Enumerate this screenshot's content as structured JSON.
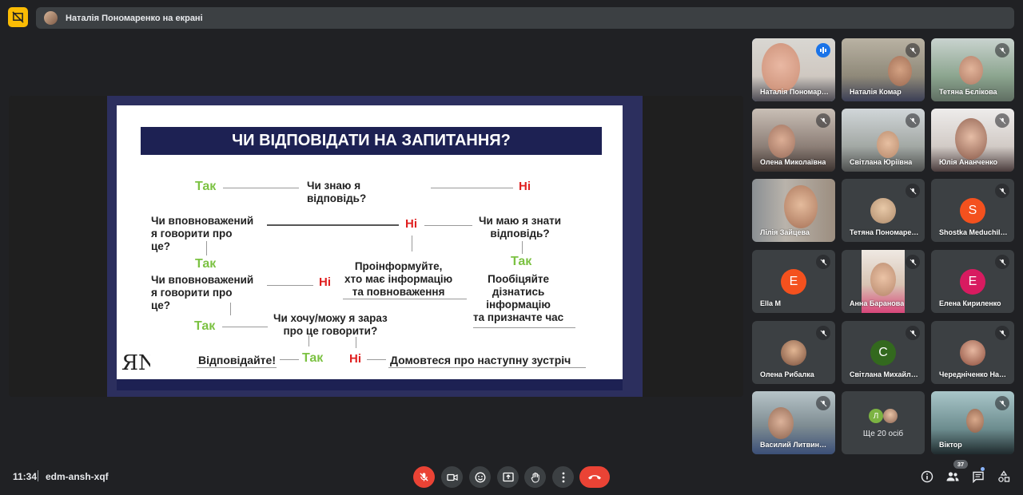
{
  "presenting_banner": "Наталія Пономаренко на екрані",
  "slide": {
    "title": "ЧИ ВІДПОВІДАТИ НА ЗАПИТАННЯ?",
    "tak": "Так",
    "ni": "Ні",
    "q1": "Чи знаю я\nвідповідь?",
    "q2": "Чи вповноважений\nя говорити про\nце?",
    "q3": "Чи маю я знати\nвідповідь?",
    "inform": "Проінформуйте,\nхто має інформацію\nта повноваження",
    "promise": "Пообіцяйте\nдізнатись\nінформацію\nта призначте час",
    "q4": "Чи вповноважений\nя говорити про\nце?",
    "q5": "Чи хочу/можу я зараз\nпро це говорити?",
    "answer": "Відповідайте!",
    "agree": "Домовтеся про наступну зустріч",
    "logo": "ЯN"
  },
  "participants": [
    {
      "name": "Наталія Пономаренко",
      "speaking": true
    },
    {
      "name": "Наталія Комар"
    },
    {
      "name": "Тетяна Бєлікова"
    },
    {
      "name": "Олена Миколаївна"
    },
    {
      "name": "Світлана Юріївна"
    },
    {
      "name": "Юлія Ананченко"
    },
    {
      "name": "Лілія Зайцева"
    },
    {
      "name": "Тетяна Пономаренко"
    },
    {
      "name": "Shostka Meduchilishe",
      "initial": "S",
      "color": "#f4511e"
    },
    {
      "name": "Ella M",
      "initial": "E",
      "color": "#f4511e"
    },
    {
      "name": "Анна Баранова"
    },
    {
      "name": "Елена Кириленко",
      "initial": "E",
      "color": "#d81b60"
    },
    {
      "name": "Олена Рибалка"
    },
    {
      "name": "Світлана Михайлівна",
      "initial": "С",
      "color": "#33691e"
    },
    {
      "name": "Чередніченко Наталія"
    },
    {
      "name": "Василий Литвиненко"
    },
    {
      "name": "Ще 20 осіб",
      "initial": "Л"
    },
    {
      "name": "Віктор"
    }
  ],
  "footer": {
    "time": "11:34",
    "meeting_code": "edm-ansh-xqf",
    "people_count": "37"
  },
  "colors": {
    "background": "#202124",
    "tile": "#3c4043",
    "accent": "#8ab4f8",
    "end_call": "#ea4335",
    "slide_navy": "#1d2153",
    "yes_green": "#7cc243",
    "no_red": "#e02020"
  }
}
